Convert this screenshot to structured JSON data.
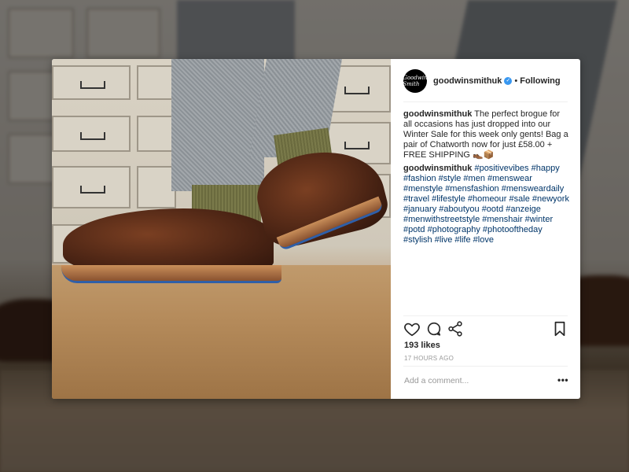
{
  "post": {
    "username": "goodwinsmithuk",
    "verified": true,
    "follow_separator": "•",
    "follow_label": "Following",
    "avatar_label": "Goodwin Smith",
    "caption_username": "goodwinsmithuk",
    "caption_text": "The perfect brogue for all occasions has just dropped into our Winter Sale for this week only gents! Bag a pair of Chatworth now for just £58.00 + FREE SHIPPING 👞📦",
    "comment_username": "goodwinsmithuk",
    "hashtags": "#positivevibes #happy #fashion #style #men #menswear #menstyle #mensfashion #mensweardaily #travel #lifestyle #homeour #sale #newyork #january #aboutyou #ootd #anzeige #menwithstreetstyle #menshair #winter #potd #photography #photooftheday #stylish #live #life #love",
    "likes": "193 likes",
    "timestamp": "17 HOURS AGO",
    "add_comment_placeholder": "Add a comment...",
    "more_label": "•••"
  },
  "colors": {
    "verified_badge": "#3897f0",
    "hashtag": "#003569",
    "text": "#262626",
    "muted": "#999999"
  }
}
